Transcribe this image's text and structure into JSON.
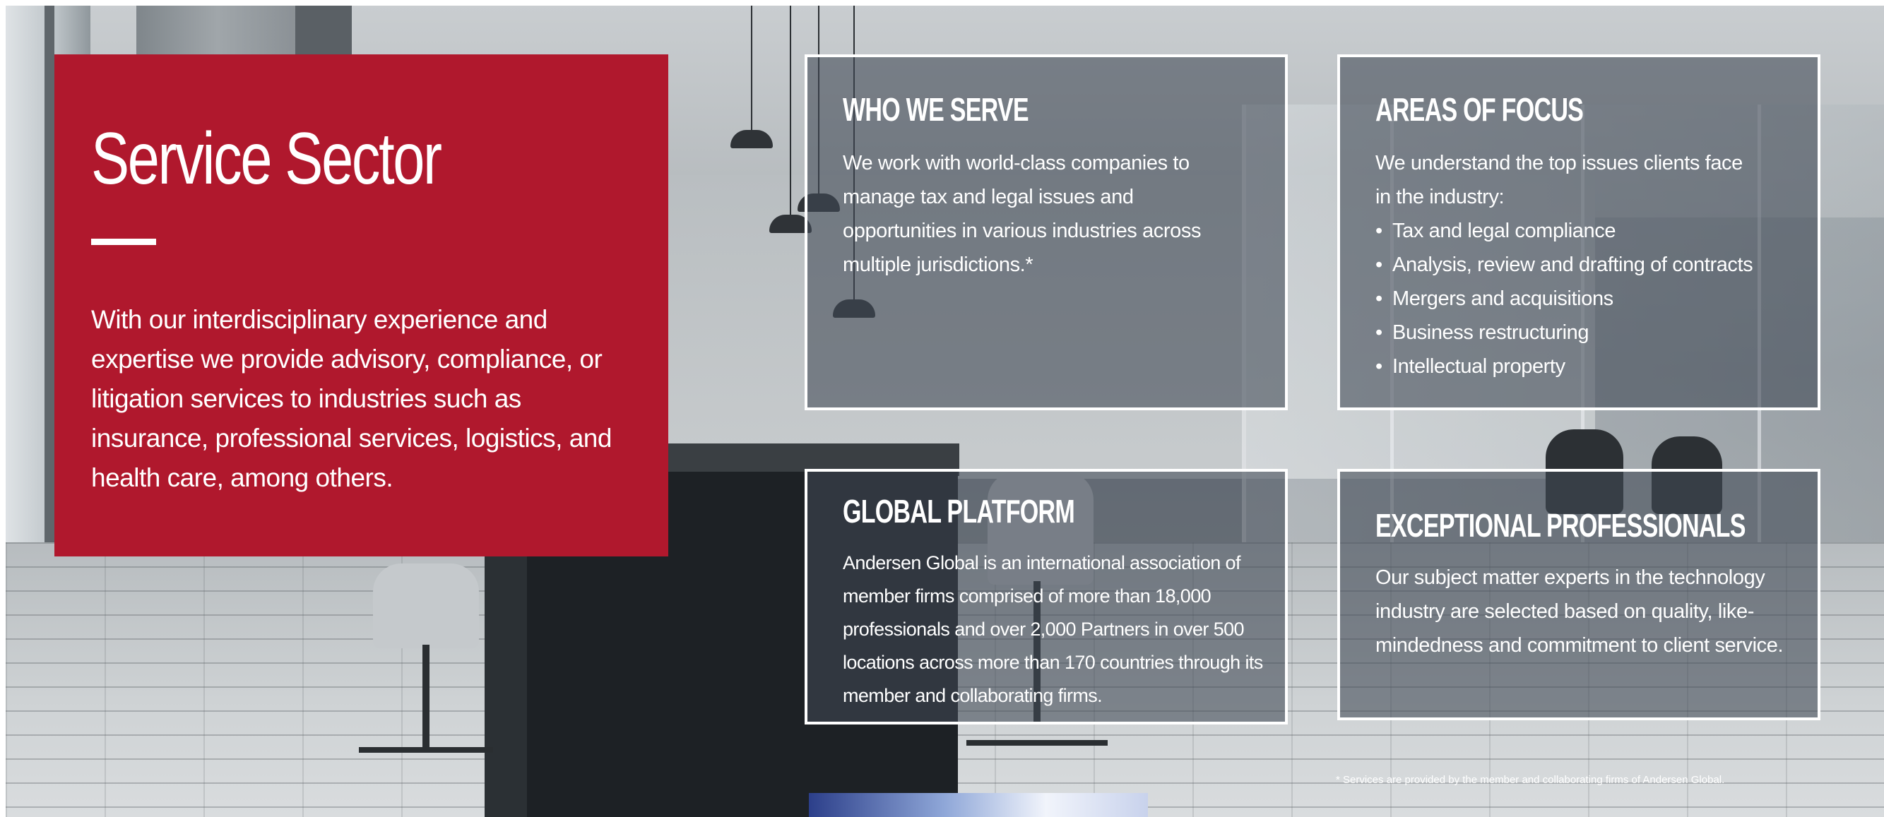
{
  "hero": {
    "title": "Service Sector",
    "description": "With our interdisciplinary experience and expertise we provide advisory, compliance, or litigation services to industries such as insurance, professional services, logistics, and health care, among others."
  },
  "cards": {
    "who_we_serve": {
      "title": "WHO WE SERVE",
      "body": "We work with world-class companies to manage tax and legal issues and opportunities in various industries across multiple jurisdictions.*"
    },
    "areas_of_focus": {
      "title": "AREAS OF FOCUS",
      "intro": "We understand the top issues clients face in the industry:",
      "items": [
        "Tax and legal compliance",
        "Analysis, review and drafting of contracts",
        "Mergers and acquisitions",
        "Business restructuring",
        "Intellectual property"
      ]
    },
    "global_platform": {
      "title": "GLOBAL PLATFORM",
      "body": "Andersen Global is an international association of member firms comprised of more than 18,000 professionals and over 2,000 Partners in over 500 locations across more than 170 countries through its member and collaborating firms."
    },
    "exceptional_professionals": {
      "title": "EXCEPTIONAL PROFESSIONALS",
      "body": "Our subject matter experts in the technology industry are selected based on quality, like-mindedness and commitment to client service."
    }
  },
  "footnote": "* Services are provided by the member and collaborating firms of Andersen Global.",
  "colors": {
    "brand_red": "#b0182d",
    "card_overlay": "#404954",
    "text": "#ffffff"
  }
}
